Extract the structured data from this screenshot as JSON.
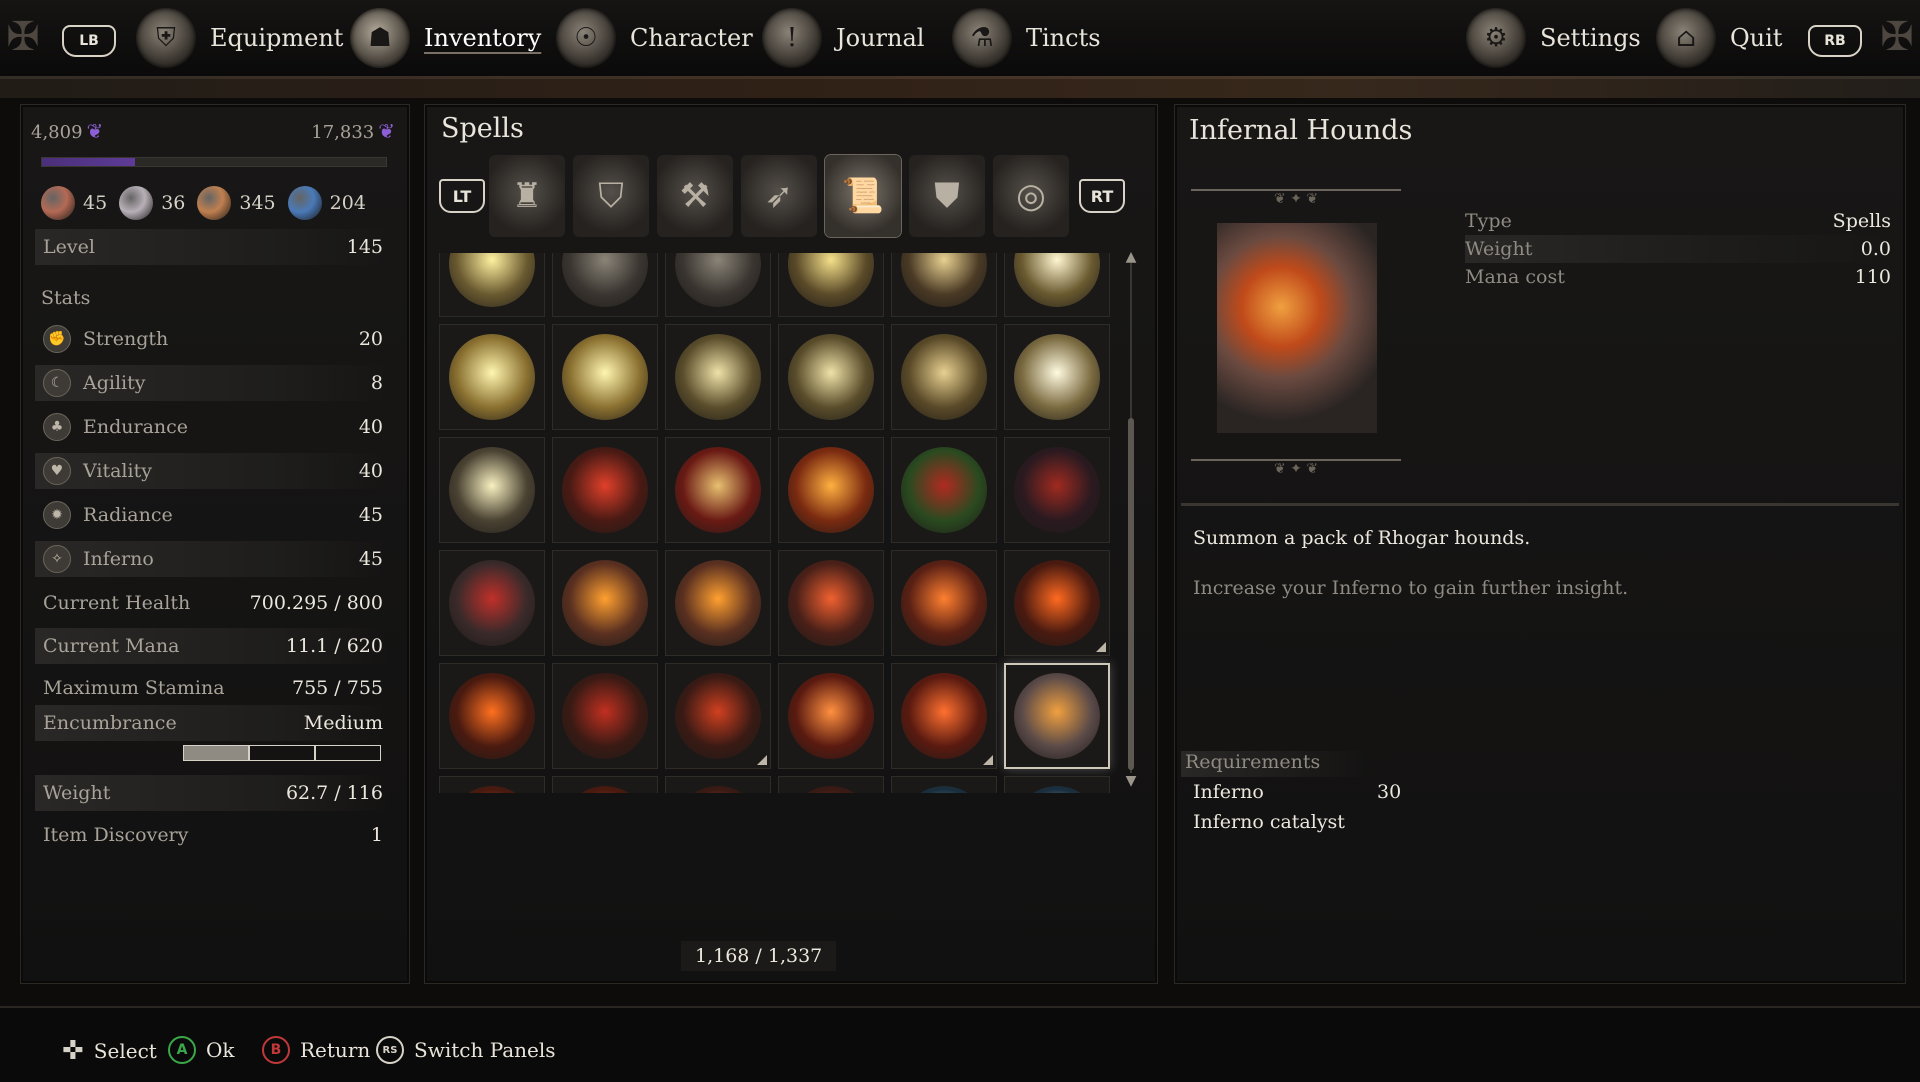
{
  "top_nav": {
    "lb": "LB",
    "rb": "RB",
    "tabs": [
      {
        "label": "Equipment",
        "icon": "helmet-icon"
      },
      {
        "label": "Inventory",
        "icon": "bag-icon",
        "active": true
      },
      {
        "label": "Character",
        "icon": "character-icon"
      },
      {
        "label": "Journal",
        "icon": "journal-icon"
      },
      {
        "label": "Tincts",
        "icon": "tincts-icon"
      }
    ],
    "settings": "Settings",
    "quit": "Quit"
  },
  "character": {
    "currency_left": "4,809",
    "currency_right": "17,833",
    "xp_progress": 0.27,
    "resources": [
      {
        "value": "45",
        "icon": "hand-icon",
        "color": "#b46a55"
      },
      {
        "value": "36",
        "icon": "orb-icon",
        "color": "#b8b0b8"
      },
      {
        "value": "345",
        "icon": "gold-nugget-icon",
        "color": "#c08050"
      },
      {
        "value": "204",
        "icon": "water-orb-icon",
        "color": "#4a7ab8"
      }
    ],
    "level_label": "Level",
    "level": "145",
    "stats_label": "Stats",
    "stats": [
      {
        "label": "Strength",
        "value": "20",
        "icon": "strength-icon"
      },
      {
        "label": "Agility",
        "value": "8",
        "icon": "agility-icon"
      },
      {
        "label": "Endurance",
        "value": "40",
        "icon": "endurance-icon"
      },
      {
        "label": "Vitality",
        "value": "40",
        "icon": "vitality-icon"
      },
      {
        "label": "Radiance",
        "value": "45",
        "icon": "radiance-icon"
      },
      {
        "label": "Inferno",
        "value": "45",
        "icon": "inferno-icon"
      }
    ],
    "health_label": "Current Health",
    "health": "700.295 / 800",
    "mana_label": "Current Mana",
    "mana": "11.1 / 620",
    "stamina_label": "Maximum Stamina",
    "stamina": "755 / 755",
    "encumbrance_label": "Encumbrance",
    "encumbrance": "Medium",
    "weight_label": "Weight",
    "weight": "62.7 / 116",
    "discovery_label": "Item Discovery",
    "discovery": "1"
  },
  "spells_panel": {
    "title": "Spells",
    "lt": "LT",
    "rt": "RT",
    "categories": [
      {
        "icon": "armor-icon"
      },
      {
        "icon": "shield-icon"
      },
      {
        "icon": "axe-icon"
      },
      {
        "icon": "arrows-icon"
      },
      {
        "icon": "scroll-icon",
        "active": true
      },
      {
        "icon": "chest-armor-icon"
      },
      {
        "icon": "ring-icon"
      }
    ],
    "slots": [
      {
        "c1": "#fff1a0",
        "c2": "#6a5a30"
      },
      {
        "c1": "#8a8478",
        "c2": "#3a3530"
      },
      {
        "c1": "#8a8478",
        "c2": "#3a3530"
      },
      {
        "c1": "#f5e08a",
        "c2": "#5a4a28"
      },
      {
        "c1": "#e8d090",
        "c2": "#4a3a25"
      },
      {
        "c1": "#fff6d0",
        "c2": "#6a5a30"
      },
      {
        "c1": "#fff6b0",
        "c2": "#8a7030"
      },
      {
        "c1": "#fff6b0",
        "c2": "#8a7030"
      },
      {
        "c1": "#efe2a8",
        "c2": "#5a4d2b"
      },
      {
        "c1": "#efe2a8",
        "c2": "#5a4d2b"
      },
      {
        "c1": "#e8d090",
        "c2": "#5a4a28"
      },
      {
        "c1": "#fffae0",
        "c2": "#7a6a40"
      },
      {
        "c1": "#f8f0c0",
        "c2": "#4a4232"
      },
      {
        "c1": "#e0402a",
        "c2": "#4a1a14"
      },
      {
        "c1": "#e8c070",
        "c2": "#6a1a14"
      },
      {
        "c1": "#ffb040",
        "c2": "#7a2a10"
      },
      {
        "c1": "#b02a20",
        "c2": "#2a4a20"
      },
      {
        "c1": "#a02a20",
        "c2": "#2a1a20"
      },
      {
        "c1": "#c0302a",
        "c2": "#3a2a2a"
      },
      {
        "c1": "#ffa030",
        "c2": "#5a3020"
      },
      {
        "c1": "#ffa030",
        "c2": "#5a3020"
      },
      {
        "c1": "#f06030",
        "c2": "#4a2018"
      },
      {
        "c1": "#ff8030",
        "c2": "#5a2014"
      },
      {
        "c1": "#ff6a20",
        "c2": "#4a1a10",
        "tick": true
      },
      {
        "c1": "#ff7020",
        "c2": "#4a1a10"
      },
      {
        "c1": "#c03020",
        "c2": "#3a1a14"
      },
      {
        "c1": "#d04020",
        "c2": "#3a1a14",
        "tick": true
      },
      {
        "c1": "#ff9040",
        "c2": "#5a1a10"
      },
      {
        "c1": "#ff7030",
        "c2": "#5a1a10",
        "tick": true
      },
      {
        "c1": "#f0a040",
        "c2": "#5a4a48",
        "selected": true
      },
      {
        "c1": "#ff6020",
        "c2": "#4a1a10"
      },
      {
        "c1": "#ff5020",
        "c2": "#4a1a10",
        "tick": true
      },
      {
        "c1": "#ff6a20",
        "c2": "#3a1a14",
        "tick": true
      },
      {
        "c1": "#c04020",
        "c2": "#3a1a14"
      },
      {
        "c1": "#a0d0f0",
        "c2": "#1a3040"
      },
      {
        "c1": "#d0f0ff",
        "c2": "#1a3040"
      },
      {
        "c1": "#70c0e0",
        "c2": "#1a3040"
      },
      {
        "c1": "#c0d0f0",
        "c2": "#2a3040"
      },
      {
        "c1": "#60b0e0",
        "c2": "#1a3040"
      },
      {
        "c1": "#a0e0ff",
        "c2": "#1a3040"
      },
      {
        "c1": "#a0c050",
        "c2": "#2a3a1a"
      },
      {
        "c1": "#70b0e0",
        "c2": "#1a3040"
      }
    ],
    "counter": "1,168 / 1,337"
  },
  "details": {
    "title": "Infernal Hounds",
    "props": [
      {
        "label": "Type",
        "value": "Spells"
      },
      {
        "label": "Weight",
        "value": "0.0"
      },
      {
        "label": "Mana cost",
        "value": "110"
      }
    ],
    "description": "Summon a pack of Rhogar hounds.",
    "insight": "Increase your Inferno to gain further insight.",
    "requirements_label": "Requirements",
    "requirements": [
      {
        "label": "Inferno",
        "value": "30"
      },
      {
        "label": "Inferno catalyst",
        "value": ""
      }
    ]
  },
  "hints": {
    "select": "Select",
    "ok": "Ok",
    "return": "Return",
    "switch": "Switch Panels",
    "a": "A",
    "b": "B",
    "rs": "RS"
  }
}
